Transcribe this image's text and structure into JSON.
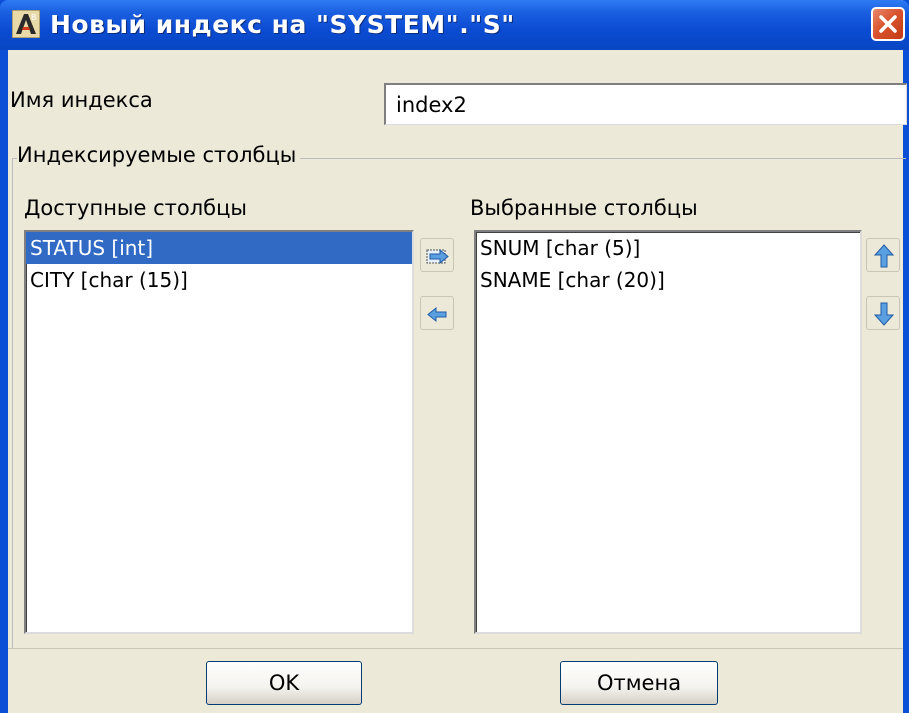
{
  "window": {
    "title": "Новый индекс на \"SYSTEM\".\"S\"",
    "title_bar_color": "#0a4fd6",
    "close_icon": "close-x-icon"
  },
  "form": {
    "index_name_label": "Имя индекса",
    "index_name_value": "index2"
  },
  "columns_group": {
    "legend": "Индексируемые столбцы",
    "available_label": "Доступные столбцы",
    "selected_label": "Выбранные столбцы",
    "available_items": [
      {
        "text": "STATUS [int]",
        "selected": true
      },
      {
        "text": "CITY [char (15)]",
        "selected": false
      }
    ],
    "selected_items": [
      {
        "text": "SNUM [char (5)]"
      },
      {
        "text": "SNAME [char (20)]"
      }
    ],
    "selection_color": "#316ac5"
  },
  "buttons": {
    "ok": "OK",
    "cancel": "Отмена"
  }
}
